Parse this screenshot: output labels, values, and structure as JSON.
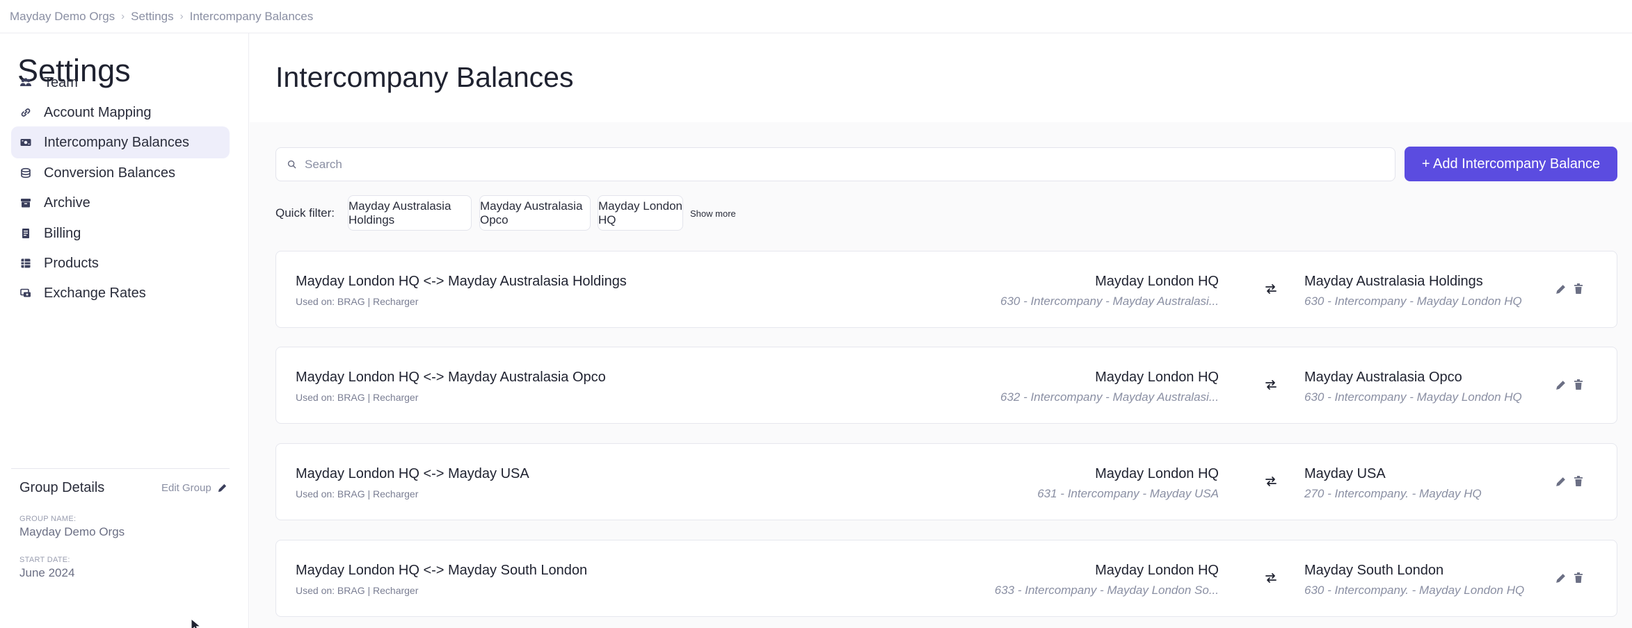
{
  "breadcrumb": {
    "items": [
      "Mayday Demo Orgs",
      "Settings",
      "Intercompany Balances"
    ],
    "separator": "›"
  },
  "sidebar": {
    "title": "Settings",
    "items": [
      {
        "label": "Team",
        "icon": "users-icon"
      },
      {
        "label": "Account Mapping",
        "icon": "link-icon"
      },
      {
        "label": "Intercompany Balances",
        "icon": "money-icon",
        "active": true
      },
      {
        "label": "Conversion Balances",
        "icon": "coins-icon"
      },
      {
        "label": "Archive",
        "icon": "archive-icon"
      },
      {
        "label": "Billing",
        "icon": "receipt-icon"
      },
      {
        "label": "Products",
        "icon": "grid-icon"
      },
      {
        "label": "Exchange Rates",
        "icon": "exchange-icon"
      }
    ],
    "group": {
      "title": "Group Details",
      "edit_label": "Edit Group",
      "name_label": "GROUP NAME:",
      "name_value": "Mayday Demo Orgs",
      "start_label": "START DATE:",
      "start_value": "June 2024"
    }
  },
  "main": {
    "title": "Intercompany Balances",
    "search": {
      "placeholder": "Search",
      "value": ""
    },
    "add_button": "+ Add Intercompany Balance",
    "quick_filter": {
      "label": "Quick filter:",
      "chips": [
        "Mayday Australasia Holdings",
        "Mayday Australasia Opco",
        "Mayday London HQ"
      ],
      "show_more": "Show more"
    },
    "balances": [
      {
        "title": "Mayday London HQ <-> Mayday Australasia Holdings",
        "used_on": "Used on: BRAG | Recharger",
        "left_entity": "Mayday London HQ",
        "left_account": "630 - Intercompany - Mayday Australasi...",
        "right_entity": "Mayday Australasia Holdings",
        "right_account": "630 - Intercompany - Mayday London HQ"
      },
      {
        "title": "Mayday London HQ <-> Mayday Australasia Opco",
        "used_on": "Used on: BRAG | Recharger",
        "left_entity": "Mayday London HQ",
        "left_account": "632 - Intercompany - Mayday Australasi...",
        "right_entity": "Mayday Australasia Opco",
        "right_account": "630 - Intercompany - Mayday London HQ"
      },
      {
        "title": "Mayday London HQ <-> Mayday USA",
        "used_on": "Used on: BRAG | Recharger",
        "left_entity": "Mayday London HQ",
        "left_account": "631 - Intercompany - Mayday USA",
        "right_entity": "Mayday USA",
        "right_account": "270 - Intercompany. - Mayday HQ"
      },
      {
        "title": "Mayday London HQ <-> Mayday South London",
        "used_on": "Used on: BRAG | Recharger",
        "left_entity": "Mayday London HQ",
        "left_account": "633 - Intercompany - Mayday London So...",
        "right_entity": "Mayday South London",
        "right_account": "630 - Intercompany. - Mayday London HQ"
      }
    ]
  },
  "colors": {
    "accent": "#5b4ce0",
    "active_nav_bg": "#eeeefa",
    "muted_text": "#8a8fa3"
  }
}
